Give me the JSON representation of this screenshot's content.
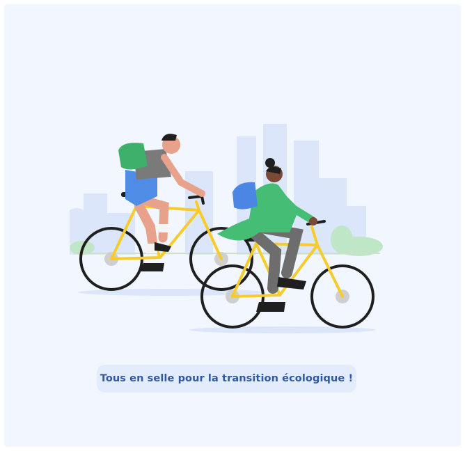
{
  "caption": {
    "text": "Tous en selle pour la transition écologique !"
  },
  "illustration": {
    "subjects": [
      "cyclist-man-icon",
      "cyclist-woman-icon",
      "city-skyline-icon",
      "bush-icon"
    ]
  },
  "colors": {
    "background": "#f2f6fe",
    "pill": "#e3ecfc",
    "caption_text": "#2f58a6",
    "skyline": "#dbe6fb",
    "bike_frame": "#f5cc2c",
    "wheel": "#1f1f1f",
    "hub": "#cfcfcf",
    "backpack_green": "#3fb06b",
    "backpack_blue": "#4b86e4",
    "shorts_blue": "#4f8ce6",
    "jacket_green": "#46bd74",
    "skin_light": "#e8a28c",
    "skin_dark": "#7a4a36",
    "shirt_gray": "#7a7a7a",
    "pants_gray": "#6d6d6d",
    "shadow": "#dce6fa",
    "bush": "#bfe6c7"
  }
}
